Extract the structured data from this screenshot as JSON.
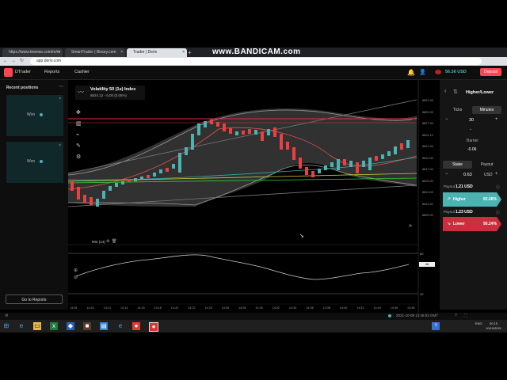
{
  "browser": {
    "tabs": [
      {
        "label": "https://www.tewnee.com/m/m"
      },
      {
        "label": "SmartTrader | Binary.com"
      },
      {
        "label": "Trader | Deriv"
      }
    ],
    "new_tab": "+",
    "watermark": "www.BANDICAM.com",
    "url": "app.deriv.com",
    "nav": {
      "back": "←",
      "forward": "→",
      "reload": "↻"
    }
  },
  "header": {
    "app_name": "DTrader",
    "reports": "Reports",
    "cashier": "Cashier",
    "balance": "56.36 USD",
    "deposit": "Deposit"
  },
  "left": {
    "title": "Recent positions",
    "positions": [
      {
        "status": "Won"
      },
      {
        "status": "Won"
      }
    ],
    "go_to_reports": "Go to Reports"
  },
  "chart": {
    "symbol": "Volatility 50 (1s) Index",
    "quote": "8824.12 - 6.00 (0.05%)",
    "price_labels": [
      "8831.00",
      "8829.00",
      "8827.00",
      "8824.12",
      "8821.00",
      "8819.00",
      "8817.00",
      "8815.00",
      "8813.00",
      "8811.00",
      "8809.00"
    ],
    "time_labels": [
      "14:08",
      "14:10",
      "14:12",
      "14:14",
      "14:16",
      "14:18",
      "14:20",
      "14:22",
      "14:24",
      "14:26",
      "14:28",
      "14:30",
      "14:32",
      "14:34",
      "14:36",
      "14:38",
      "14:40",
      "14:42",
      "14:44",
      "14:46",
      "14:48"
    ],
    "rsi_label": "RSI (14)",
    "rsi_value": "48",
    "rsi_levels": [
      "80",
      "20"
    ],
    "current_badge": "8824.12"
  },
  "right": {
    "trade_type": "Higher/Lower",
    "tabs": [
      "Ticks",
      "Minutes"
    ],
    "duration": "30",
    "barrier_label": "Barrier",
    "barrier": "-0.06",
    "stake_tabs": [
      "Stake",
      "Payout"
    ],
    "amount": "0.63",
    "currency": "USD",
    "higher": {
      "payout_label": "Payout",
      "payout": "1.21 USD",
      "label": "Higher",
      "pct": "92.06%"
    },
    "lower": {
      "payout_label": "Payout",
      "payout": "1.23 USD",
      "label": "Lower",
      "pct": "95.24%"
    }
  },
  "statusbar": {
    "time": "2021-10-09 13:46:53 GMT"
  },
  "taskbar": {
    "clock": "00:15",
    "date": "10/10/2021",
    "lang": "ENG"
  },
  "colors": {
    "accent": "#ff444f",
    "profit": "#4bb4b3",
    "up": "#4bb4b3",
    "down": "#ec3f3f"
  }
}
